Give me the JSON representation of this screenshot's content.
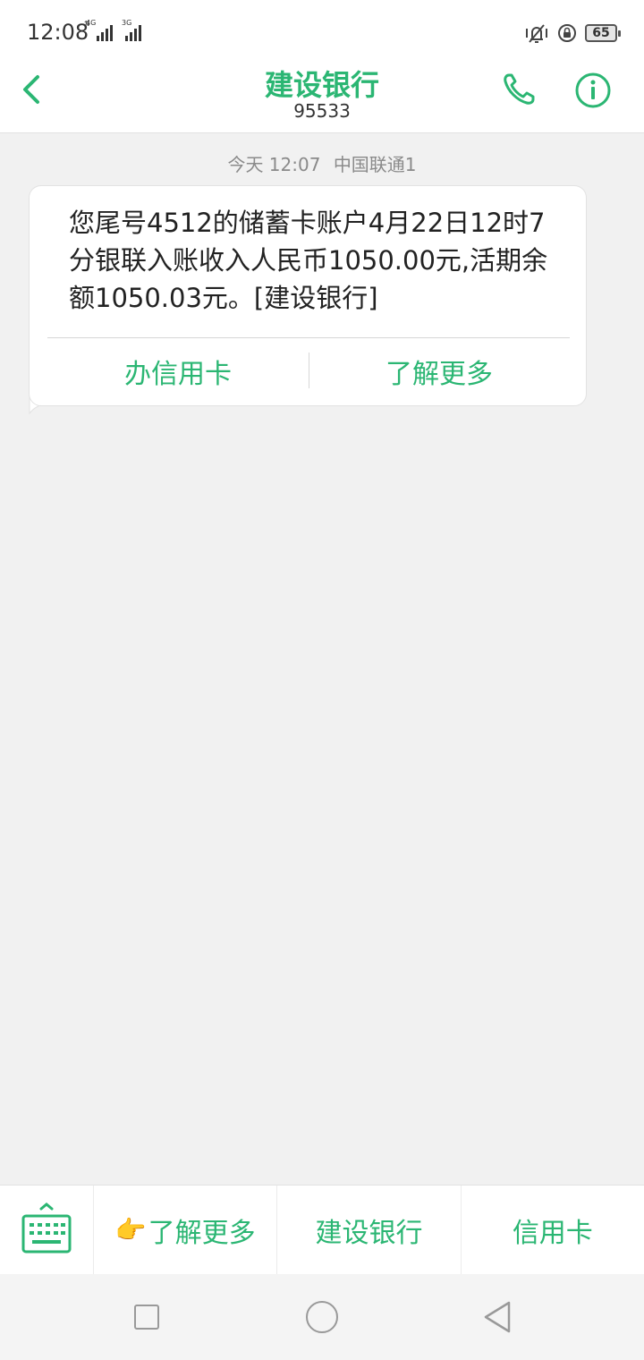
{
  "status_bar": {
    "time": "12:08",
    "signal1_label": "4G",
    "signal2_label": "3G",
    "battery": "65"
  },
  "header": {
    "title": "建设银行",
    "number": "95533"
  },
  "conversation": {
    "timestamp": "今天 12:07",
    "sim": "中国联通1",
    "message": "您尾号4512的储蓄卡账户4月22日12时7分银联入账收入人民币1050.00元,活期余额1050.03元。[建设银行]",
    "actions": [
      "办信用卡",
      "了解更多"
    ]
  },
  "menu": {
    "emoji": "👉",
    "items": [
      "了解更多",
      "建设银行",
      "信用卡"
    ]
  },
  "colors": {
    "accent": "#2bb673",
    "background": "#f1f1f1",
    "bubble": "#ffffff"
  },
  "icons": {
    "back": "chevron-left-icon",
    "call": "phone-icon",
    "info": "info-icon",
    "keyboard": "keyboard-icon",
    "nav_recent": "square-icon",
    "nav_home": "circle-icon",
    "nav_back": "triangle-back-icon"
  }
}
